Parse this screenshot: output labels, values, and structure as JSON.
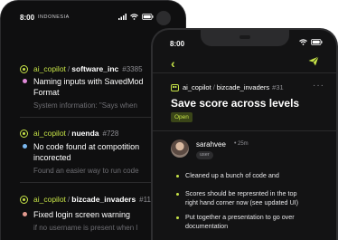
{
  "back_phone": {
    "status_bar": {
      "time": "8:00",
      "carrier": "INDONESIA"
    },
    "items": [
      {
        "repo": "ai_copilot",
        "project": "software_inc",
        "number": "#3385",
        "dot_color": "#e08ad9",
        "title_line1": "Naming inputs with SavedMod",
        "title_line2": "Format",
        "preview": "System information: \"Says when"
      },
      {
        "repo": "ai_copilot",
        "project": "nuenda",
        "number": "#728",
        "dot_color": "#7ab8f0",
        "title_line1": "No code found at compotition",
        "title_line2": "incorected",
        "preview": "Found an easier way to run code"
      },
      {
        "repo": "ai_copilot",
        "project": "bizcade_invaders",
        "number": "#11",
        "dot_color": "#e39a8f",
        "title_line1": "Fixed login screen warning",
        "preview": "if no username is present when l"
      }
    ]
  },
  "front_phone": {
    "status_bar": {
      "time": "8:00"
    },
    "issue": {
      "repo": "ai_copilot",
      "project": "bizcade_invaders",
      "number": "#31",
      "title": "Save score across levels",
      "status": "Open"
    },
    "comment": {
      "author": "sarahvee",
      "time_ago": "25m",
      "role": "user",
      "bullets": [
        {
          "lines": [
            "Cleaned up a bunch of code and"
          ]
        },
        {
          "lines": [
            "Scores should be represnted in the top",
            "right hand corner now (see updated UI)"
          ]
        },
        {
          "lines": [
            "Put  together a presentation to go over",
            "documentation"
          ]
        }
      ]
    }
  },
  "icons": {
    "back": "chevron-left-icon",
    "send": "paper-plane-icon",
    "more": "more-dots-icon",
    "status": "open-status-icon",
    "bot": "robot-icon"
  },
  "colors": {
    "accent": "#c6e347",
    "background": "#131314"
  }
}
